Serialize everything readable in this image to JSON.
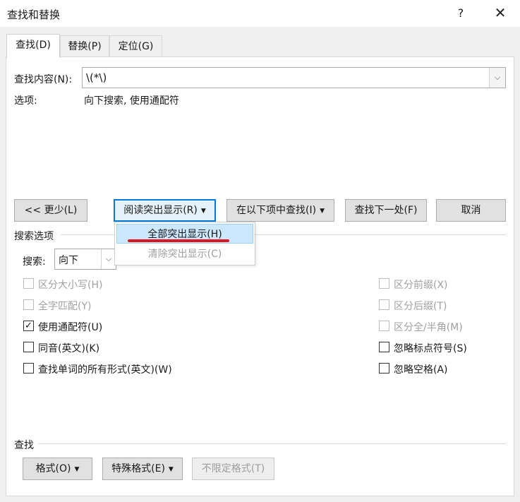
{
  "window": {
    "title": "查找和替换",
    "help": "?",
    "close": "✕"
  },
  "tabs": [
    {
      "label": "查找(D)",
      "key": "D",
      "active": true
    },
    {
      "label": "替换(P)",
      "key": "P",
      "active": false
    },
    {
      "label": "定位(G)",
      "key": "G",
      "active": false
    }
  ],
  "find": {
    "label": "查找内容(N):",
    "value": "\\(*\\)",
    "options_label": "选项:",
    "options_value": "向下搜索, 使用通配符"
  },
  "buttons": {
    "less": "<< 更少(L)",
    "reading_highlight": "阅读突出显示(R)",
    "find_in": "在以下项中查找(I)",
    "find_next": "查找下一处(F)",
    "cancel": "取消"
  },
  "menu": {
    "highlight_all": "全部突出显示(H)",
    "clear_highlight": "清除突出显示(C)"
  },
  "search_options": {
    "section_label": "搜索选项",
    "search_label": "搜索:",
    "search_value": "向下"
  },
  "checkboxes_left": [
    {
      "label": "区分大小写(H)",
      "checked": false,
      "enabled": false
    },
    {
      "label": "全字匹配(Y)",
      "checked": false,
      "enabled": false
    },
    {
      "label": "使用通配符(U)",
      "checked": true,
      "enabled": true
    },
    {
      "label": "同音(英文)(K)",
      "checked": false,
      "enabled": true
    },
    {
      "label": "查找单词的所有形式(英文)(W)",
      "checked": false,
      "enabled": true
    }
  ],
  "checkboxes_right": [
    {
      "label": "区分前缀(X)",
      "checked": false,
      "enabled": false
    },
    {
      "label": "区分后缀(T)",
      "checked": false,
      "enabled": false
    },
    {
      "label": "区分全/半角(M)",
      "checked": false,
      "enabled": false
    },
    {
      "label": "忽略标点符号(S)",
      "checked": false,
      "enabled": true
    },
    {
      "label": "忽略空格(A)",
      "checked": false,
      "enabled": true
    }
  ],
  "find_section": {
    "label": "查找",
    "format": "格式(O)",
    "special": "特殊格式(E)",
    "no_format": "不限定格式(T)"
  },
  "colors": {
    "accent": "#0078d7",
    "menu_highlight": "#cce8ff",
    "annotation": "#e0141e"
  }
}
